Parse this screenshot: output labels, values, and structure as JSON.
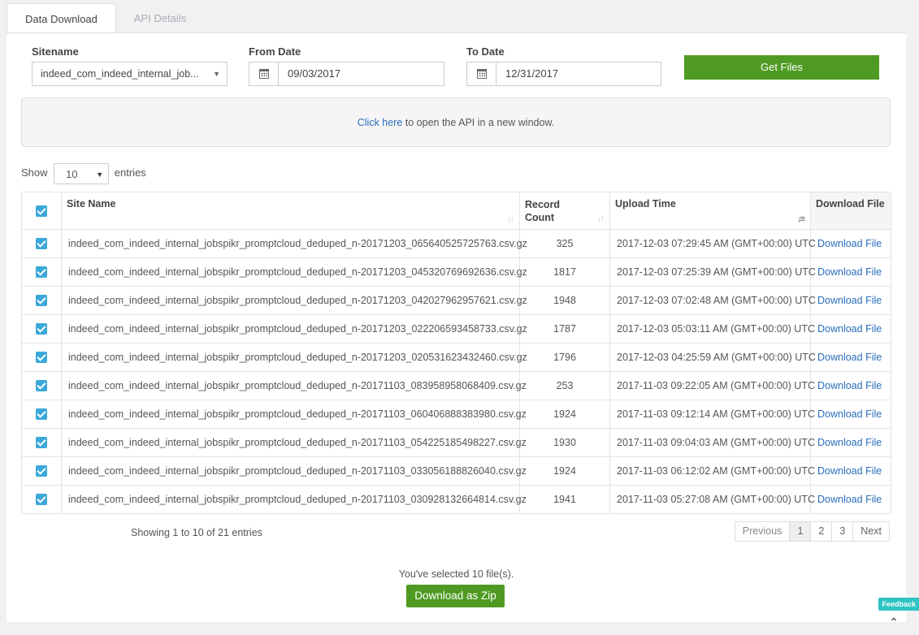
{
  "tabs": [
    {
      "label": "Data Download",
      "active": true
    },
    {
      "label": "API Details",
      "active": false
    }
  ],
  "form": {
    "sitename_label": "Sitename",
    "sitename_value": "indeed_com_indeed_internal_job...",
    "from_label": "From Date",
    "from_value": "09/03/2017",
    "to_label": "To Date",
    "to_value": "12/31/2017",
    "get_files": "Get Files"
  },
  "api_notice": {
    "link": "Click here",
    "text": " to open the API in a new window."
  },
  "length": {
    "show": "Show",
    "value": "10",
    "entries": "entries"
  },
  "table": {
    "headers": {
      "site_name": "Site Name",
      "record_count": "Record Count",
      "upload_time": "Upload Time",
      "download_file": "Download File"
    },
    "rows": [
      {
        "name": "indeed_com_indeed_internal_jobspikr_promptcloud_deduped_n-20171203_065640525725763.csv.gz",
        "count": "325",
        "time": "2017-12-03 07:29:45 AM (GMT+00:00) UTC",
        "link": "Download File"
      },
      {
        "name": "indeed_com_indeed_internal_jobspikr_promptcloud_deduped_n-20171203_045320769692636.csv.gz",
        "count": "1817",
        "time": "2017-12-03 07:25:39 AM (GMT+00:00) UTC",
        "link": "Download File"
      },
      {
        "name": "indeed_com_indeed_internal_jobspikr_promptcloud_deduped_n-20171203_042027962957621.csv.gz",
        "count": "1948",
        "time": "2017-12-03 07:02:48 AM (GMT+00:00) UTC",
        "link": "Download File"
      },
      {
        "name": "indeed_com_indeed_internal_jobspikr_promptcloud_deduped_n-20171203_022206593458733.csv.gz",
        "count": "1787",
        "time": "2017-12-03 05:03:11 AM (GMT+00:00) UTC",
        "link": "Download File"
      },
      {
        "name": "indeed_com_indeed_internal_jobspikr_promptcloud_deduped_n-20171203_020531623432460.csv.gz",
        "count": "1796",
        "time": "2017-12-03 04:25:59 AM (GMT+00:00) UTC",
        "link": "Download File"
      },
      {
        "name": "indeed_com_indeed_internal_jobspikr_promptcloud_deduped_n-20171103_083958958068409.csv.gz",
        "count": "253",
        "time": "2017-11-03 09:22:05 AM (GMT+00:00) UTC",
        "link": "Download File"
      },
      {
        "name": "indeed_com_indeed_internal_jobspikr_promptcloud_deduped_n-20171103_060406888383980.csv.gz",
        "count": "1924",
        "time": "2017-11-03 09:12:14 AM (GMT+00:00) UTC",
        "link": "Download File"
      },
      {
        "name": "indeed_com_indeed_internal_jobspikr_promptcloud_deduped_n-20171103_054225185498227.csv.gz",
        "count": "1930",
        "time": "2017-11-03 09:04:03 AM (GMT+00:00) UTC",
        "link": "Download File"
      },
      {
        "name": "indeed_com_indeed_internal_jobspikr_promptcloud_deduped_n-20171103_033056188826040.csv.gz",
        "count": "1924",
        "time": "2017-11-03 06:12:02 AM (GMT+00:00) UTC",
        "link": "Download File"
      },
      {
        "name": "indeed_com_indeed_internal_jobspikr_promptcloud_deduped_n-20171103_030928132664814.csv.gz",
        "count": "1941",
        "time": "2017-11-03 05:27:08 AM (GMT+00:00) UTC",
        "link": "Download File"
      }
    ]
  },
  "info": "Showing 1 to 10 of 21 entries",
  "pagination": {
    "previous": "Previous",
    "pages": [
      "1",
      "2",
      "3"
    ],
    "next": "Next"
  },
  "selection": {
    "text": "You've selected 10 file(s).",
    "button": "Download as Zip"
  },
  "feedback": "Feedback",
  "colors": {
    "accent_green": "#4f9a22",
    "checkbox_blue": "#3ba9d9",
    "link_blue": "#2a6ebb",
    "feedback_teal": "#2ec4c4"
  }
}
